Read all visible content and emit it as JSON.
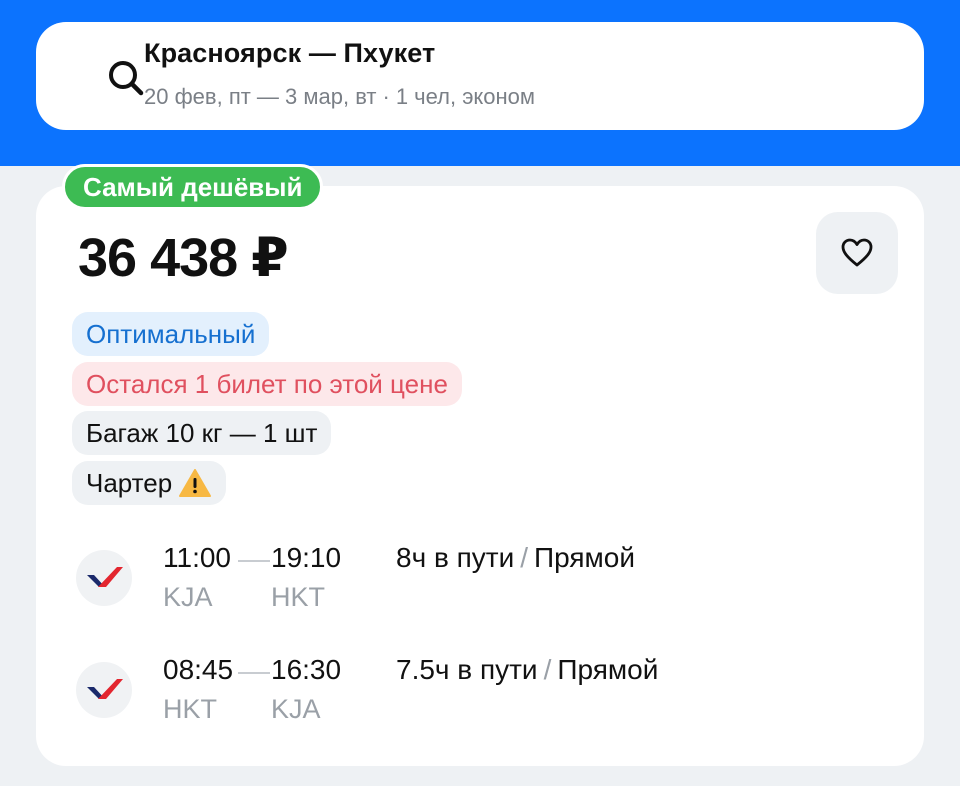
{
  "search": {
    "route": "Красноярск — Пхукет",
    "dates": "20 фев, пт — 3 мар, вт",
    "separator": "·",
    "passengers": "1 чел, эконом"
  },
  "offer": {
    "badge": "Самый дешёвый",
    "price": "36 438 ₽",
    "tags": {
      "optimal": "Оптимальный",
      "last_ticket": "Остался 1 билет по этой цене",
      "baggage": "Багаж 10 кг — 1 шт",
      "charter": "Чартер"
    },
    "segments": [
      {
        "dep_time": "11:00",
        "arr_time": "19:10",
        "dep_code": "KJA",
        "arr_code": "HKT",
        "duration": "8ч в пути",
        "slash": "/",
        "type": "Прямой"
      },
      {
        "dep_time": "08:45",
        "arr_time": "16:30",
        "dep_code": "HKT",
        "arr_code": "KJA",
        "duration": "7.5ч в пути",
        "slash": "/",
        "type": "Прямой"
      }
    ]
  },
  "colors": {
    "header_blue": "#0c73fe",
    "badge_green": "#3dbb53",
    "optimal_blue": "#1670d0",
    "warning_red": "#e0505f",
    "warning_amber": "#f7b843"
  },
  "icons": {
    "search": "search-icon",
    "favorite": "heart-icon",
    "warning": "warning-icon",
    "airline": "airline-logo-icon"
  }
}
